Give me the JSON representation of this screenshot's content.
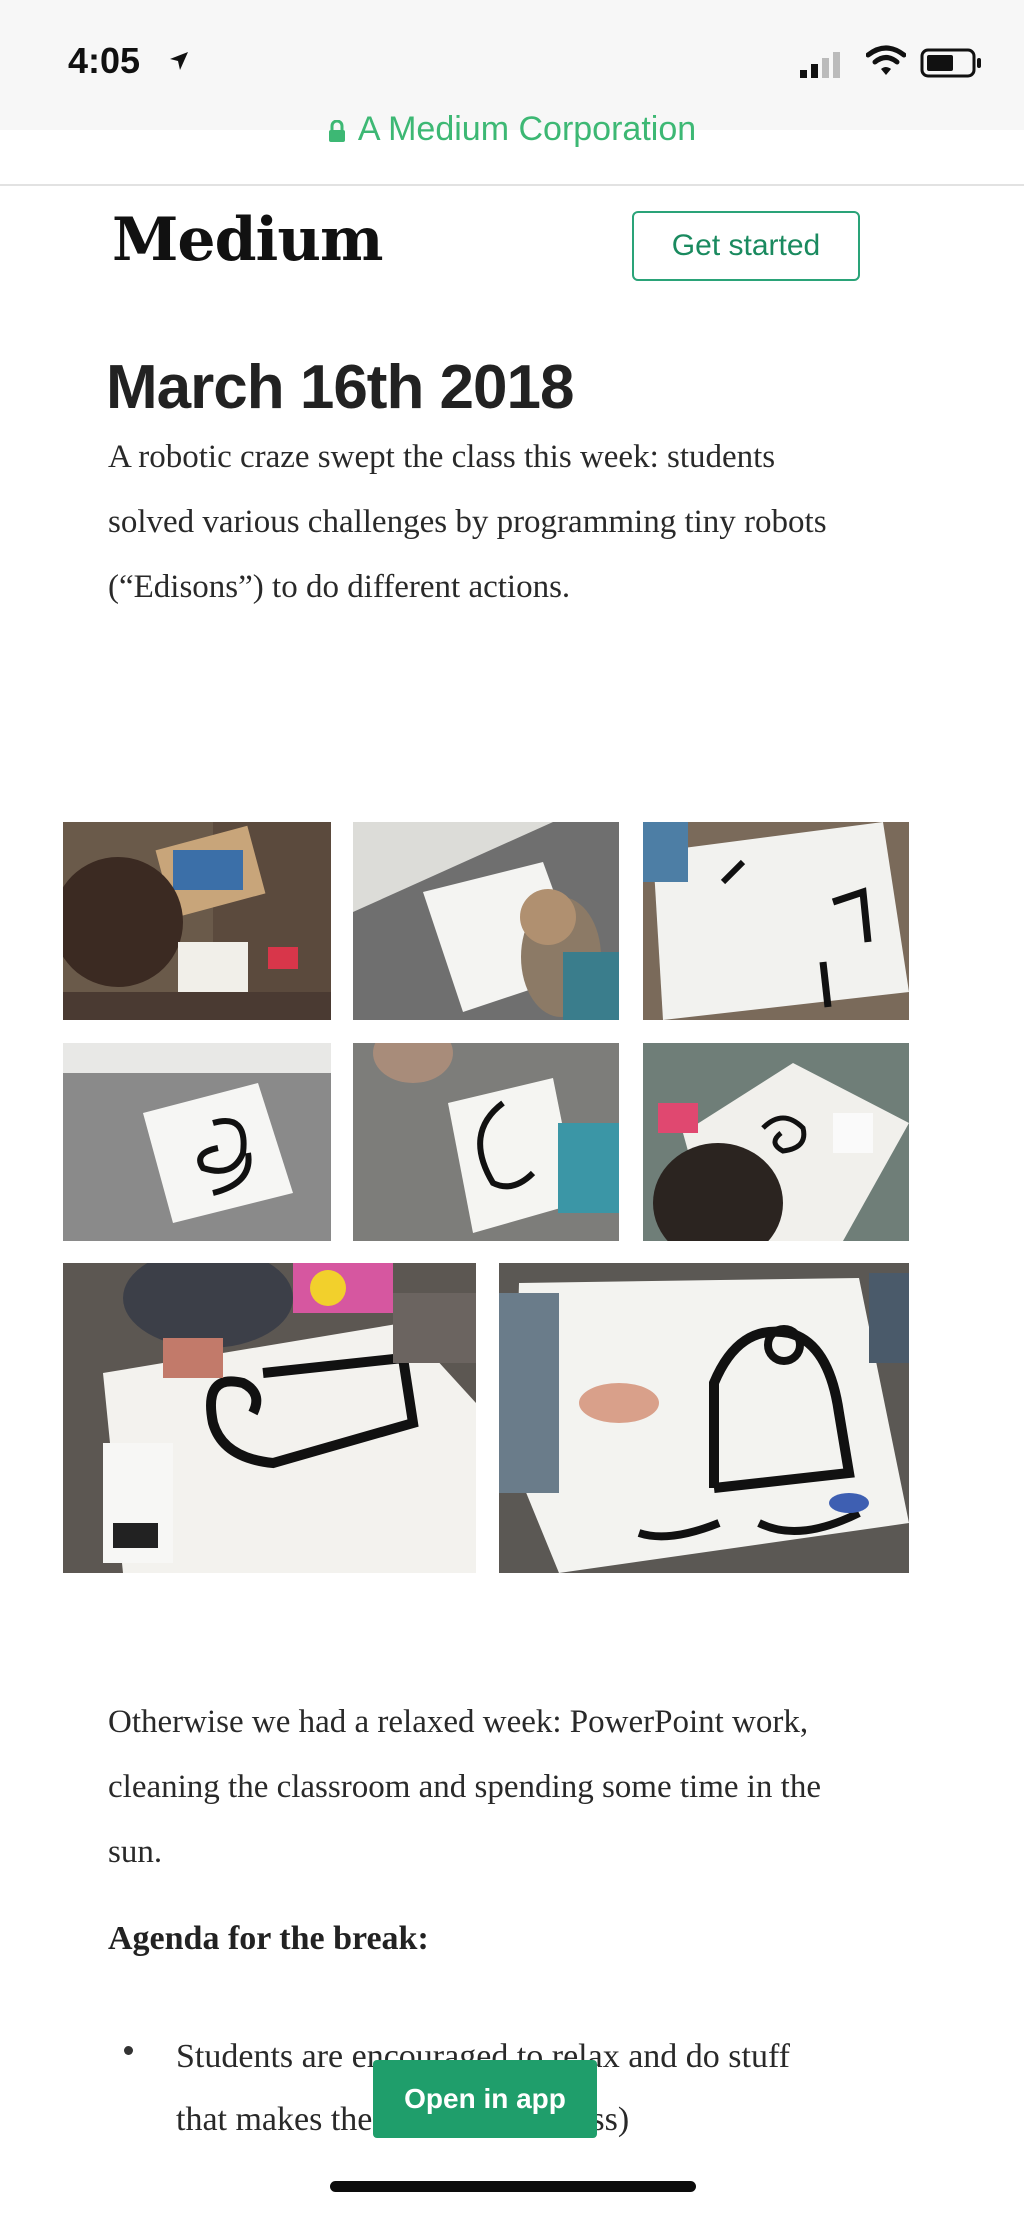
{
  "status": {
    "time": "4:05",
    "url": "A Medium Corporation"
  },
  "header": {
    "logo": "Medium",
    "get_started": "Get started"
  },
  "article": {
    "title": "March 16th 2018",
    "intro": "A robotic craze swept the class this week: students solved various challenges by programming tiny robots (“Edisons”) to do different actions.",
    "photos": [
      {
        "icon": "photo-students-boxes"
      },
      {
        "icon": "photo-child-drawing"
      },
      {
        "icon": "photo-track-paper"
      },
      {
        "icon": "photo-paper-spiral"
      },
      {
        "icon": "photo-paper-curve"
      },
      {
        "icon": "photo-table-spiral"
      },
      {
        "icon": "photo-track-loop"
      },
      {
        "icon": "photo-track-arch"
      }
    ],
    "body": "Otherwise we had a relaxed week: PowerPoint work, cleaning the classroom and spending some time in the sun.",
    "agenda_heading": "Agenda for the break:",
    "agenda_items": [
      "Students are encouraged to relax and do stuff that makes them happy (destress)"
    ]
  },
  "actions": {
    "open_in_app": "Open in app"
  },
  "colors": {
    "accent": "#3db874",
    "button_green": "#1f9e6b"
  }
}
